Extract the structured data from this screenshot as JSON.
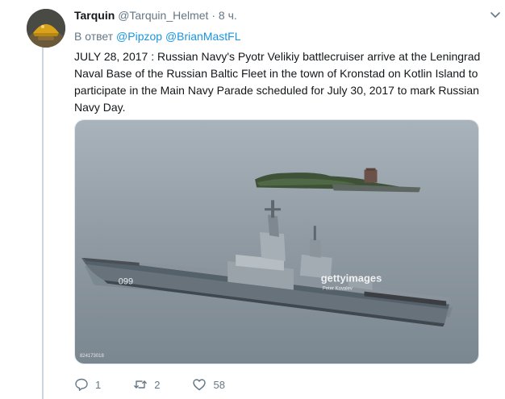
{
  "tweet": {
    "author_name": "Tarquin",
    "author_handle": "@Tarquin_Helmet",
    "separator": "·",
    "time": "8 ч.",
    "reply_prefix": "В ответ",
    "reply_to": [
      "@Pipzop",
      "@BrianMastFL"
    ],
    "text": "JULY 28, 2017 : Russian Navy's Pyotr Velikiy battlecruiser arrive at the Leningrad Naval Base of the Russian Baltic Fleet in the town of Kronstad on Kotlin Island to participate in the Main Navy Parade scheduled for July 30, 2017 to mark Russian Navy Day."
  },
  "media": {
    "hull_number": "099",
    "watermark_brand": "gettyimages",
    "watermark_credit": "Peter Kovalev",
    "image_id": "824173018"
  },
  "actions": {
    "reply_count": "1",
    "retweet_count": "2",
    "like_count": "58"
  },
  "icons": {
    "menu": "chevron-down-icon",
    "reply": "reply-icon",
    "retweet": "retweet-icon",
    "like": "heart-icon"
  },
  "colors": {
    "link": "#1b95e0",
    "muted": "#657786",
    "text": "#14171a",
    "thread_line": "#ccd6dd"
  }
}
